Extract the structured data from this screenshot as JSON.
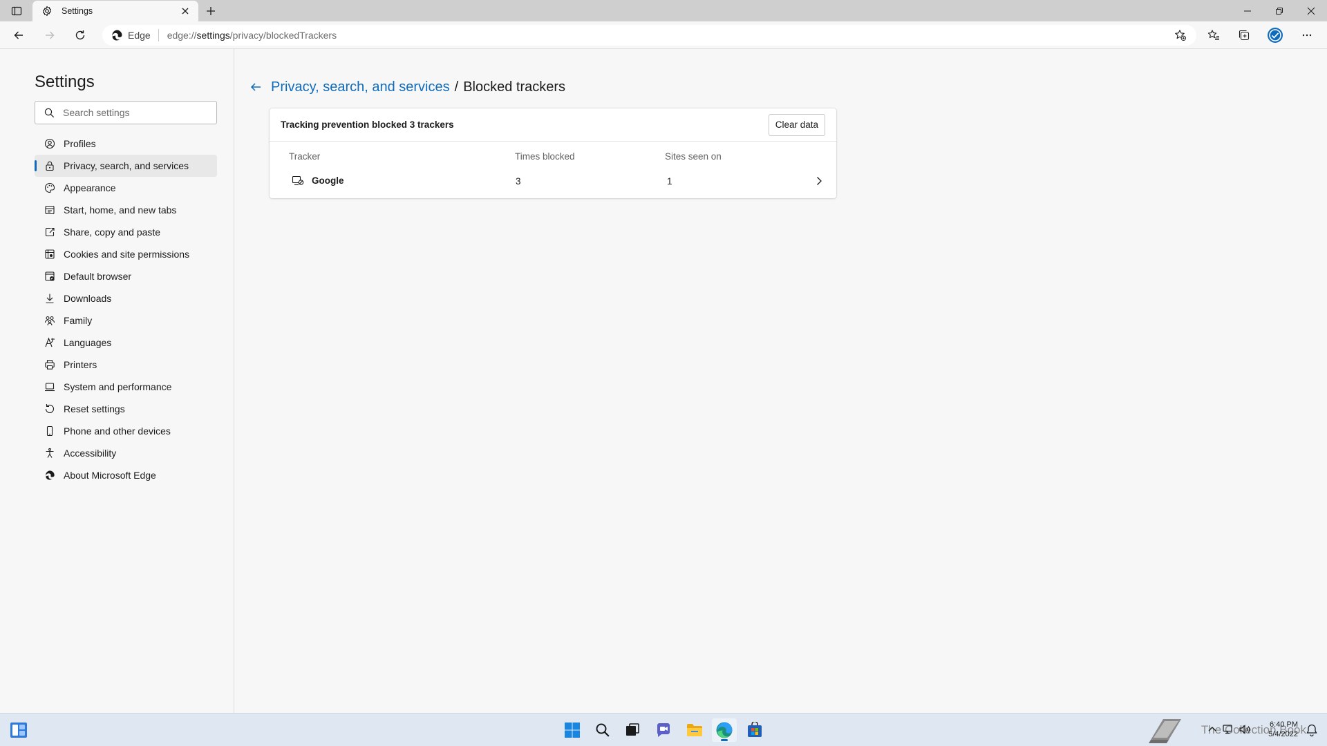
{
  "browser": {
    "tab": {
      "title": "Settings",
      "icon": "gear-icon"
    },
    "address": {
      "identity_label": "Edge",
      "url_prefix": "edge://",
      "url_host": "settings",
      "url_path": "/privacy/blockedTrackers"
    }
  },
  "sidebar": {
    "title": "Settings",
    "search_placeholder": "Search settings",
    "items": [
      {
        "label": "Profiles",
        "icon": "profile-icon",
        "active": false
      },
      {
        "label": "Privacy, search, and services",
        "icon": "lock-icon",
        "active": true
      },
      {
        "label": "Appearance",
        "icon": "appearance-icon",
        "active": false
      },
      {
        "label": "Start, home, and new tabs",
        "icon": "home-tabs-icon",
        "active": false
      },
      {
        "label": "Share, copy and paste",
        "icon": "share-icon",
        "active": false
      },
      {
        "label": "Cookies and site permissions",
        "icon": "cookies-icon",
        "active": false
      },
      {
        "label": "Default browser",
        "icon": "default-browser-icon",
        "active": false
      },
      {
        "label": "Downloads",
        "icon": "download-icon",
        "active": false
      },
      {
        "label": "Family",
        "icon": "family-icon",
        "active": false
      },
      {
        "label": "Languages",
        "icon": "languages-icon",
        "active": false
      },
      {
        "label": "Printers",
        "icon": "printer-icon",
        "active": false
      },
      {
        "label": "System and performance",
        "icon": "laptop-icon",
        "active": false
      },
      {
        "label": "Reset settings",
        "icon": "reset-icon",
        "active": false
      },
      {
        "label": "Phone and other devices",
        "icon": "phone-icon",
        "active": false
      },
      {
        "label": "Accessibility",
        "icon": "accessibility-icon",
        "active": false
      },
      {
        "label": "About Microsoft Edge",
        "icon": "edge-logo-icon",
        "active": false
      }
    ]
  },
  "main": {
    "breadcrumb": {
      "parent": "Privacy, search, and services",
      "separator": "/",
      "current": "Blocked trackers"
    },
    "card": {
      "title": "Tracking prevention blocked 3 trackers",
      "clear_button": "Clear data",
      "columns": [
        "Tracker",
        "Times blocked",
        "Sites seen on"
      ],
      "rows": [
        {
          "tracker": "Google",
          "times_blocked": "3",
          "sites_seen_on": "1"
        }
      ]
    }
  },
  "taskbar": {
    "watermark_text": "The Collection Book",
    "clock_time": "6:40 PM",
    "clock_date": "5/4/2022"
  },
  "colors": {
    "accent": "#0f6cbd",
    "background": "#f7f7f7",
    "card": "#ffffff",
    "taskbar": "#dfe8f2"
  }
}
